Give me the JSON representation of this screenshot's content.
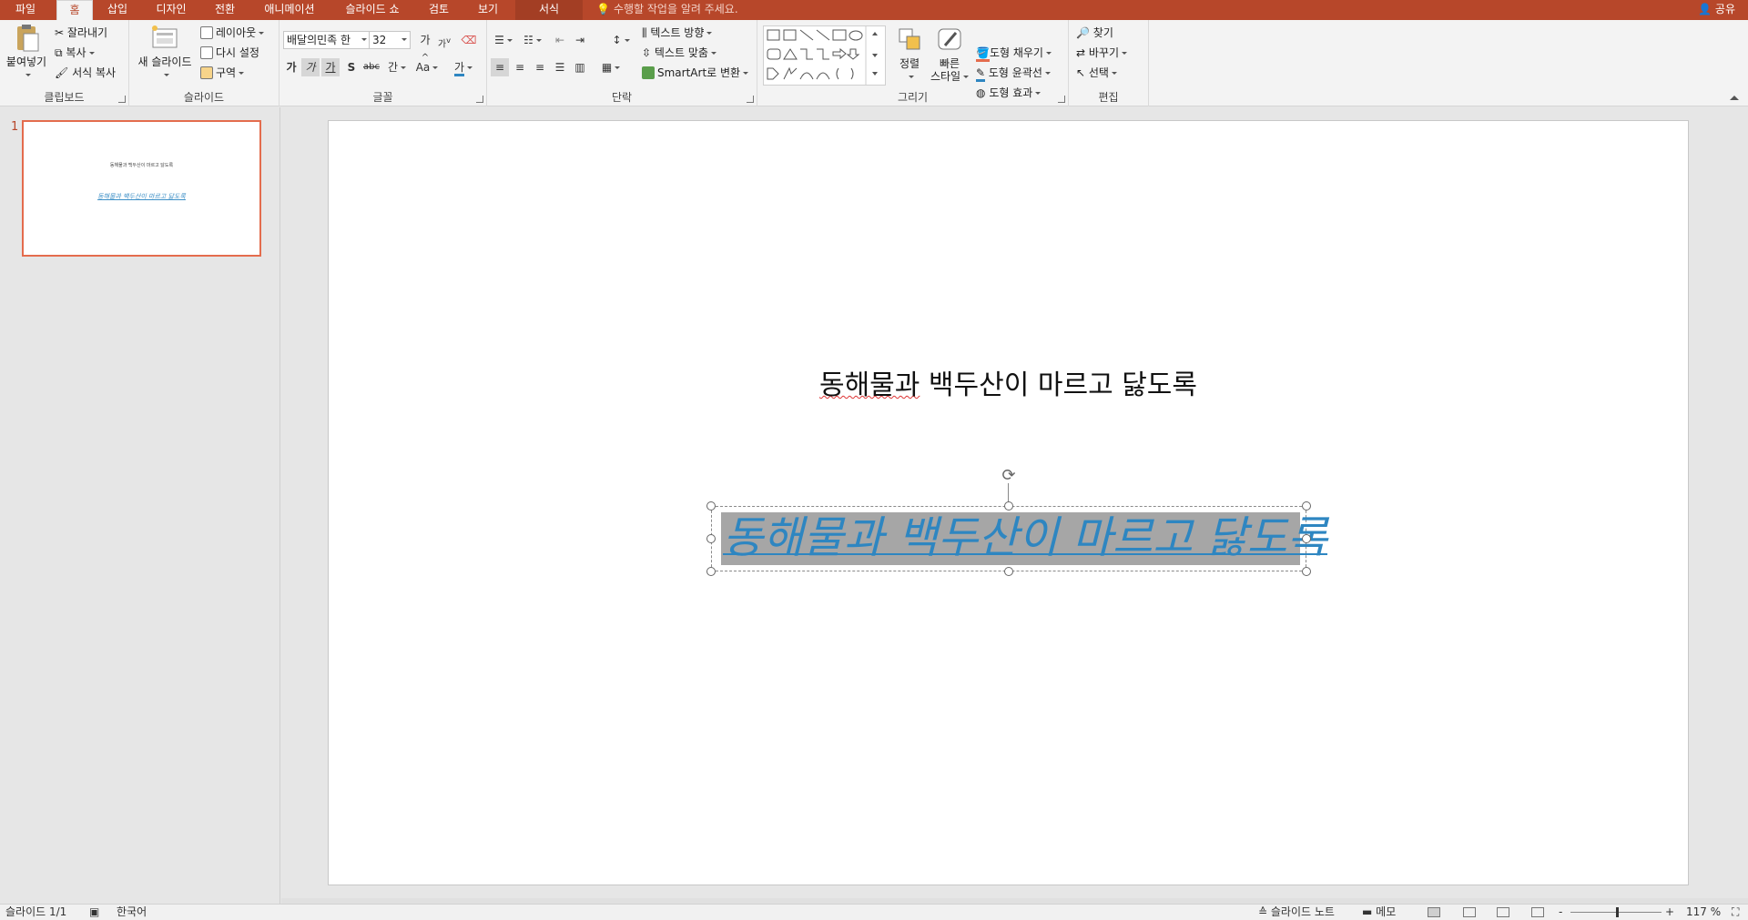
{
  "tabs": [
    {
      "label": "파일",
      "active": false
    },
    {
      "label": "홈",
      "active": true
    },
    {
      "label": "삽입",
      "active": false
    },
    {
      "label": "디자인",
      "active": false
    },
    {
      "label": "전환",
      "active": false
    },
    {
      "label": "애니메이션",
      "active": false
    },
    {
      "label": "슬라이드 쇼",
      "active": false
    },
    {
      "label": "검토",
      "active": false
    },
    {
      "label": "보기",
      "active": false
    },
    {
      "label": "서식",
      "active": false,
      "contextual": true
    }
  ],
  "tell_me": "수행할 작업을 알려 주세요.",
  "share": "공유",
  "clipboard": {
    "label": "클립보드",
    "paste": "붙여넣기",
    "cut": "잘라내기",
    "copy": "복사",
    "format_painter": "서식 복사"
  },
  "slides_group": {
    "label": "슬라이드",
    "new_slide": "새 슬라이드",
    "layout": "레이아웃",
    "reset": "다시 설정",
    "section": "구역"
  },
  "font": {
    "label": "글꼴",
    "family": "배달의민족 한",
    "size": "32",
    "grow": "가",
    "shrink": "가",
    "bold": "가",
    "italic": "가",
    "underline": "가",
    "shadow": "S",
    "strike": "abc",
    "spacing": "간",
    "case": "Aa",
    "color": "가"
  },
  "paragraph": {
    "label": "단락",
    "text_direction": "텍스트 방향",
    "align_text": "텍스트 맞춤",
    "smartart": "SmartArt로 변환"
  },
  "drawing": {
    "label": "그리기",
    "arrange": "정렬",
    "quick_styles": [
      "빠른",
      "스타일"
    ],
    "fill": "도형 채우기",
    "outline": "도형 윤곽선",
    "effects": "도형 효과"
  },
  "editing": {
    "label": "편집",
    "find": "찾기",
    "replace": "바꾸기",
    "select": "선택"
  },
  "thumbnail": {
    "number": "1",
    "title": "동해물과 백두산이 마르고 닳도록",
    "subtitle": "동해물과 백두산이 마르고 닳도록"
  },
  "slide": {
    "title": "동해물과 백두산이 마르고 닳도록",
    "title_squiggle": "동해물과",
    "title_rest": " 백두산이 마르고 닳도록",
    "subtitle": "동해물과 백두산이 마르고 닳도록"
  },
  "status": {
    "slide_count": "슬라이드 1/1",
    "language": "한국어",
    "notes": "슬라이드 노트",
    "comments": "메모",
    "zoom": "117 %",
    "zoom_minus": "-",
    "zoom_plus": "+"
  },
  "colors": {
    "accent": "#b7472a",
    "subtitle_text": "#2e86c1",
    "highlight": "#a6a6a6"
  }
}
